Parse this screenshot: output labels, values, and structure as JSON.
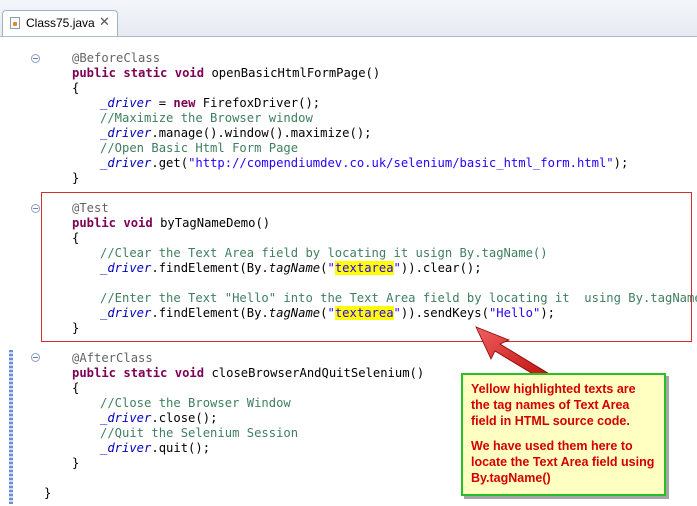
{
  "tab": {
    "title": "Class75.java",
    "close": "✕"
  },
  "code": {
    "l1": {
      "annot": "@BeforeClass"
    },
    "l2": {
      "kw1": "public",
      "kw2": "static",
      "kw3": "void",
      "rest": " openBasicHtmlFormPage()"
    },
    "l3": {
      "text": "{"
    },
    "l4": {
      "field": "_driver",
      "mid": " = ",
      "kw": "new",
      "rest": " FirefoxDriver();"
    },
    "l5": {
      "comment": "//Maximize the Browser window"
    },
    "l6": {
      "field": "_driver",
      "rest": ".manage().window().maximize();"
    },
    "l7": {
      "comment": "//Open Basic Html Form Page"
    },
    "l8": {
      "field": "_driver",
      "pre": ".get(",
      "str": "\"http://compendiumdev.co.uk/selenium/basic_html_form.html\"",
      "post": ");"
    },
    "l9": {
      "text": "}"
    },
    "l10": {
      "annot": "@Test"
    },
    "l11": {
      "kw1": "public",
      "kw2": "void",
      "rest": " byTagNameDemo()"
    },
    "l12": {
      "text": "{"
    },
    "l13": {
      "comment": "//Clear the Text Area field by locating it usign By.tagName()"
    },
    "l14": {
      "field": "_driver",
      "pre": ".findElement(By.",
      "method": "tagName",
      "open": "(",
      "q1": "\"",
      "hl": "textarea",
      "q2": "\"",
      "post": ")).clear();"
    },
    "l15": {
      "comment": "//Enter the Text \"Hello\" into the Text Area field by locating it  using By.tagName()"
    },
    "l16": {
      "field": "_driver",
      "pre": ".findElement(By.",
      "method": "tagName",
      "open": "(",
      "q1": "\"",
      "hl": "textarea",
      "q2": "\"",
      "mid": ")).sendKeys(",
      "str": "\"Hello\"",
      "post": ");"
    },
    "l17": {
      "text": "}"
    },
    "l18": {
      "annot": "@AfterClass"
    },
    "l19": {
      "kw1": "public",
      "kw2": "static",
      "kw3": "void",
      "rest": " closeBrowserAndQuitSelenium()"
    },
    "l20": {
      "text": "{"
    },
    "l21": {
      "comment": "//Close the Browser Window"
    },
    "l22": {
      "field": "_driver",
      "rest": ".close();"
    },
    "l23": {
      "comment": "//Quit the Selenium Session"
    },
    "l24": {
      "field": "_driver",
      "rest": ".quit();"
    },
    "l25": {
      "text": "}"
    },
    "l26": {
      "text": "}"
    }
  },
  "callout": {
    "p1": "Yellow highlighted texts are the tag names of Text Area field in HTML source code.",
    "p2": "We have used them here to locate the Text Area field using By.tagName()"
  },
  "colors": {
    "keyword": "#7f0055",
    "field": "#0000c0",
    "comment": "#3f7f5f",
    "string": "#2a00ff",
    "annotation": "#646464",
    "highlight": "#ffff00",
    "box": "#d32e2e",
    "callout_text": "#d40000",
    "callout_border": "#27c127"
  }
}
